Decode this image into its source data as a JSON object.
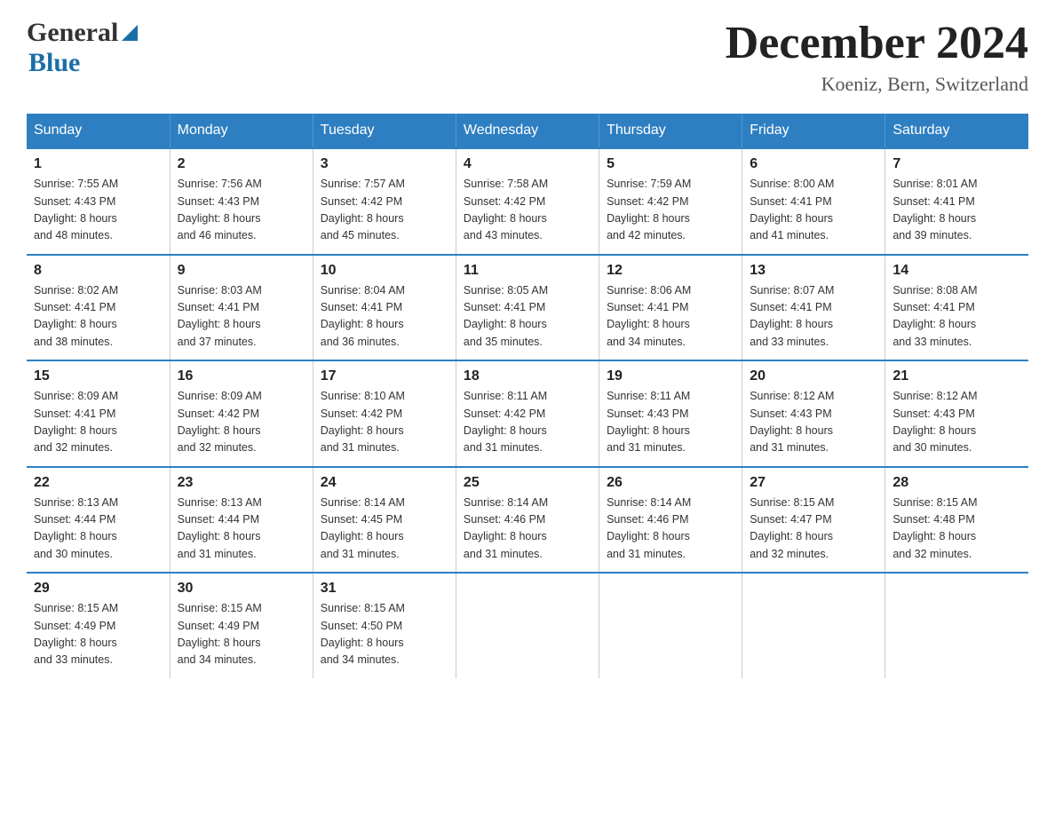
{
  "logo": {
    "general": "General",
    "blue": "Blue",
    "triangle": "▶"
  },
  "header": {
    "month_title": "December 2024",
    "location": "Koeniz, Bern, Switzerland"
  },
  "days_of_week": [
    "Sunday",
    "Monday",
    "Tuesday",
    "Wednesday",
    "Thursday",
    "Friday",
    "Saturday"
  ],
  "weeks": [
    [
      {
        "num": "1",
        "sunrise": "Sunrise: 7:55 AM",
        "sunset": "Sunset: 4:43 PM",
        "daylight": "Daylight: 8 hours",
        "daylight2": "and 48 minutes."
      },
      {
        "num": "2",
        "sunrise": "Sunrise: 7:56 AM",
        "sunset": "Sunset: 4:43 PM",
        "daylight": "Daylight: 8 hours",
        "daylight2": "and 46 minutes."
      },
      {
        "num": "3",
        "sunrise": "Sunrise: 7:57 AM",
        "sunset": "Sunset: 4:42 PM",
        "daylight": "Daylight: 8 hours",
        "daylight2": "and 45 minutes."
      },
      {
        "num": "4",
        "sunrise": "Sunrise: 7:58 AM",
        "sunset": "Sunset: 4:42 PM",
        "daylight": "Daylight: 8 hours",
        "daylight2": "and 43 minutes."
      },
      {
        "num": "5",
        "sunrise": "Sunrise: 7:59 AM",
        "sunset": "Sunset: 4:42 PM",
        "daylight": "Daylight: 8 hours",
        "daylight2": "and 42 minutes."
      },
      {
        "num": "6",
        "sunrise": "Sunrise: 8:00 AM",
        "sunset": "Sunset: 4:41 PM",
        "daylight": "Daylight: 8 hours",
        "daylight2": "and 41 minutes."
      },
      {
        "num": "7",
        "sunrise": "Sunrise: 8:01 AM",
        "sunset": "Sunset: 4:41 PM",
        "daylight": "Daylight: 8 hours",
        "daylight2": "and 39 minutes."
      }
    ],
    [
      {
        "num": "8",
        "sunrise": "Sunrise: 8:02 AM",
        "sunset": "Sunset: 4:41 PM",
        "daylight": "Daylight: 8 hours",
        "daylight2": "and 38 minutes."
      },
      {
        "num": "9",
        "sunrise": "Sunrise: 8:03 AM",
        "sunset": "Sunset: 4:41 PM",
        "daylight": "Daylight: 8 hours",
        "daylight2": "and 37 minutes."
      },
      {
        "num": "10",
        "sunrise": "Sunrise: 8:04 AM",
        "sunset": "Sunset: 4:41 PM",
        "daylight": "Daylight: 8 hours",
        "daylight2": "and 36 minutes."
      },
      {
        "num": "11",
        "sunrise": "Sunrise: 8:05 AM",
        "sunset": "Sunset: 4:41 PM",
        "daylight": "Daylight: 8 hours",
        "daylight2": "and 35 minutes."
      },
      {
        "num": "12",
        "sunrise": "Sunrise: 8:06 AM",
        "sunset": "Sunset: 4:41 PM",
        "daylight": "Daylight: 8 hours",
        "daylight2": "and 34 minutes."
      },
      {
        "num": "13",
        "sunrise": "Sunrise: 8:07 AM",
        "sunset": "Sunset: 4:41 PM",
        "daylight": "Daylight: 8 hours",
        "daylight2": "and 33 minutes."
      },
      {
        "num": "14",
        "sunrise": "Sunrise: 8:08 AM",
        "sunset": "Sunset: 4:41 PM",
        "daylight": "Daylight: 8 hours",
        "daylight2": "and 33 minutes."
      }
    ],
    [
      {
        "num": "15",
        "sunrise": "Sunrise: 8:09 AM",
        "sunset": "Sunset: 4:41 PM",
        "daylight": "Daylight: 8 hours",
        "daylight2": "and 32 minutes."
      },
      {
        "num": "16",
        "sunrise": "Sunrise: 8:09 AM",
        "sunset": "Sunset: 4:42 PM",
        "daylight": "Daylight: 8 hours",
        "daylight2": "and 32 minutes."
      },
      {
        "num": "17",
        "sunrise": "Sunrise: 8:10 AM",
        "sunset": "Sunset: 4:42 PM",
        "daylight": "Daylight: 8 hours",
        "daylight2": "and 31 minutes."
      },
      {
        "num": "18",
        "sunrise": "Sunrise: 8:11 AM",
        "sunset": "Sunset: 4:42 PM",
        "daylight": "Daylight: 8 hours",
        "daylight2": "and 31 minutes."
      },
      {
        "num": "19",
        "sunrise": "Sunrise: 8:11 AM",
        "sunset": "Sunset: 4:43 PM",
        "daylight": "Daylight: 8 hours",
        "daylight2": "and 31 minutes."
      },
      {
        "num": "20",
        "sunrise": "Sunrise: 8:12 AM",
        "sunset": "Sunset: 4:43 PM",
        "daylight": "Daylight: 8 hours",
        "daylight2": "and 31 minutes."
      },
      {
        "num": "21",
        "sunrise": "Sunrise: 8:12 AM",
        "sunset": "Sunset: 4:43 PM",
        "daylight": "Daylight: 8 hours",
        "daylight2": "and 30 minutes."
      }
    ],
    [
      {
        "num": "22",
        "sunrise": "Sunrise: 8:13 AM",
        "sunset": "Sunset: 4:44 PM",
        "daylight": "Daylight: 8 hours",
        "daylight2": "and 30 minutes."
      },
      {
        "num": "23",
        "sunrise": "Sunrise: 8:13 AM",
        "sunset": "Sunset: 4:44 PM",
        "daylight": "Daylight: 8 hours",
        "daylight2": "and 31 minutes."
      },
      {
        "num": "24",
        "sunrise": "Sunrise: 8:14 AM",
        "sunset": "Sunset: 4:45 PM",
        "daylight": "Daylight: 8 hours",
        "daylight2": "and 31 minutes."
      },
      {
        "num": "25",
        "sunrise": "Sunrise: 8:14 AM",
        "sunset": "Sunset: 4:46 PM",
        "daylight": "Daylight: 8 hours",
        "daylight2": "and 31 minutes."
      },
      {
        "num": "26",
        "sunrise": "Sunrise: 8:14 AM",
        "sunset": "Sunset: 4:46 PM",
        "daylight": "Daylight: 8 hours",
        "daylight2": "and 31 minutes."
      },
      {
        "num": "27",
        "sunrise": "Sunrise: 8:15 AM",
        "sunset": "Sunset: 4:47 PM",
        "daylight": "Daylight: 8 hours",
        "daylight2": "and 32 minutes."
      },
      {
        "num": "28",
        "sunrise": "Sunrise: 8:15 AM",
        "sunset": "Sunset: 4:48 PM",
        "daylight": "Daylight: 8 hours",
        "daylight2": "and 32 minutes."
      }
    ],
    [
      {
        "num": "29",
        "sunrise": "Sunrise: 8:15 AM",
        "sunset": "Sunset: 4:49 PM",
        "daylight": "Daylight: 8 hours",
        "daylight2": "and 33 minutes."
      },
      {
        "num": "30",
        "sunrise": "Sunrise: 8:15 AM",
        "sunset": "Sunset: 4:49 PM",
        "daylight": "Daylight: 8 hours",
        "daylight2": "and 34 minutes."
      },
      {
        "num": "31",
        "sunrise": "Sunrise: 8:15 AM",
        "sunset": "Sunset: 4:50 PM",
        "daylight": "Daylight: 8 hours",
        "daylight2": "and 34 minutes."
      },
      {
        "num": "",
        "sunrise": "",
        "sunset": "",
        "daylight": "",
        "daylight2": ""
      },
      {
        "num": "",
        "sunrise": "",
        "sunset": "",
        "daylight": "",
        "daylight2": ""
      },
      {
        "num": "",
        "sunrise": "",
        "sunset": "",
        "daylight": "",
        "daylight2": ""
      },
      {
        "num": "",
        "sunrise": "",
        "sunset": "",
        "daylight": "",
        "daylight2": ""
      }
    ]
  ]
}
